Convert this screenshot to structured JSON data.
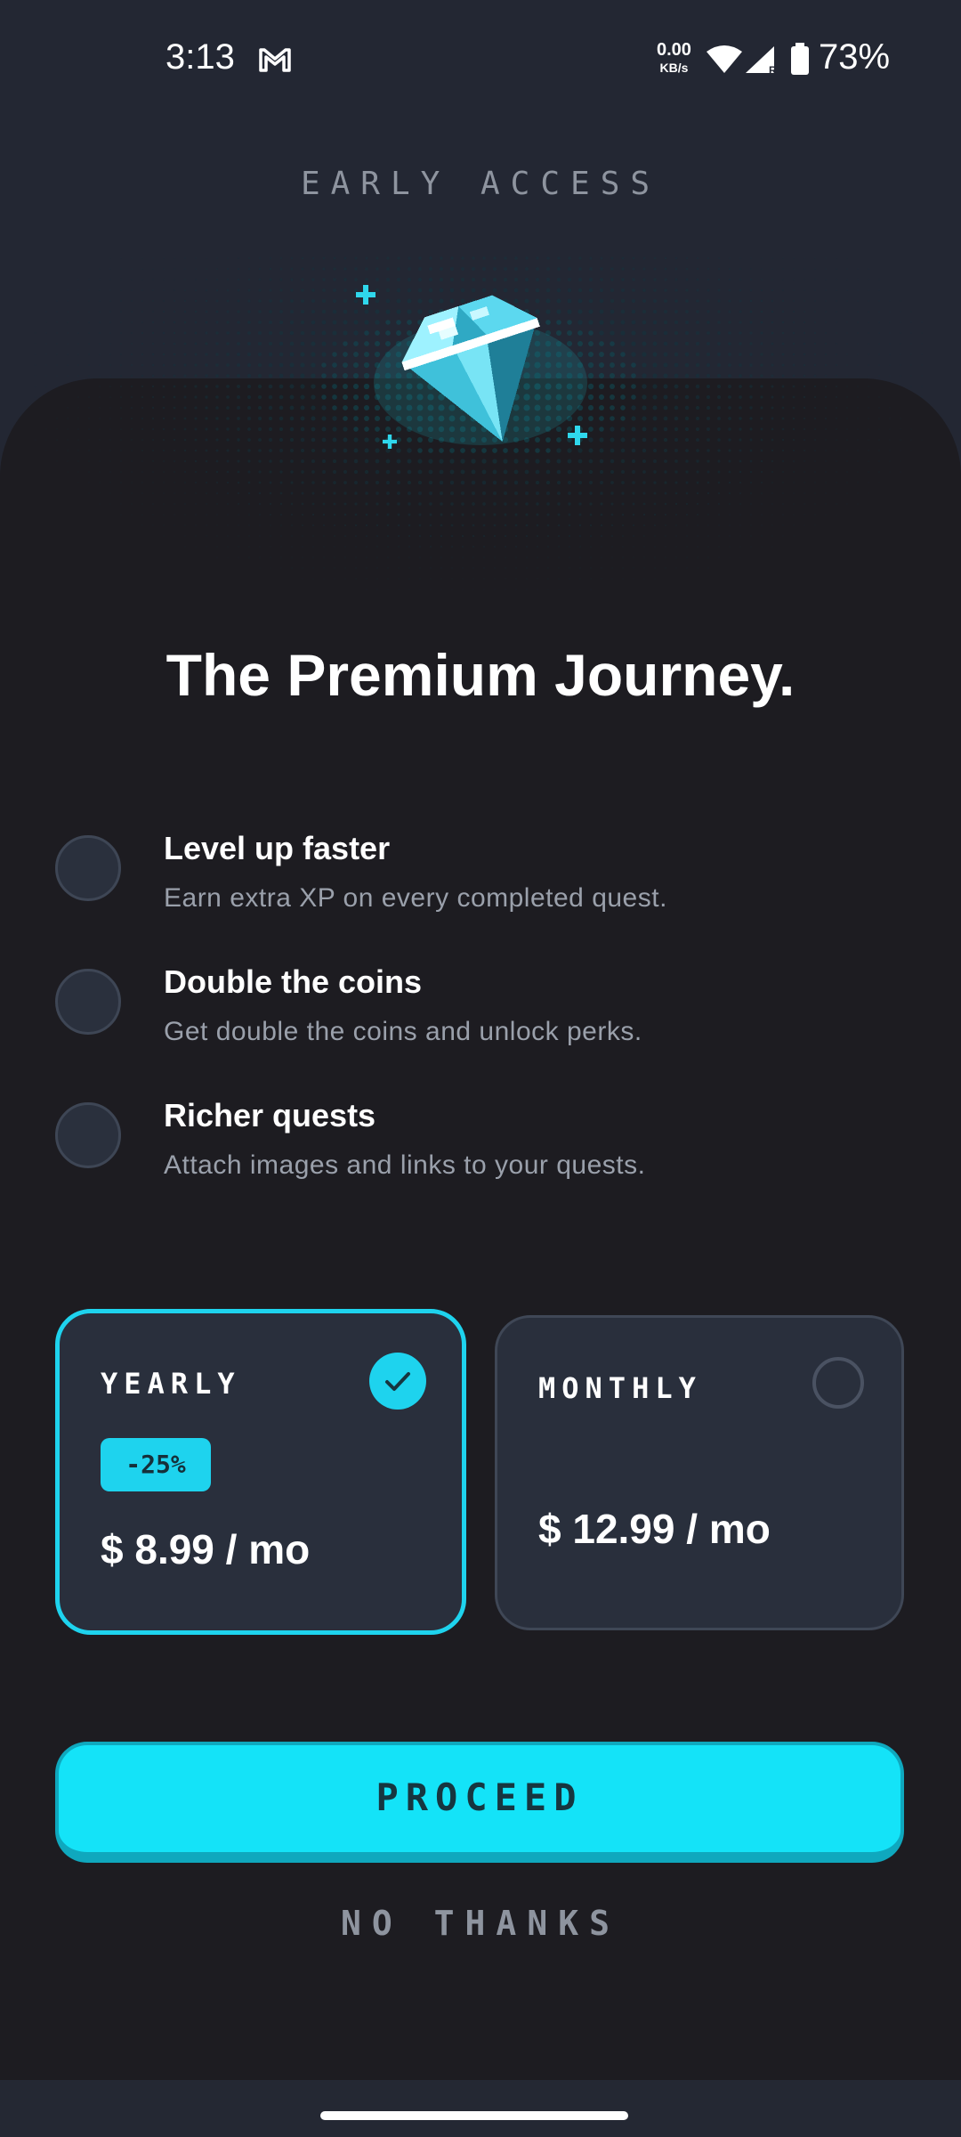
{
  "status_bar": {
    "time": "3:13",
    "net_speed_value": "0.00",
    "net_speed_unit": "KB/s",
    "battery": "73%",
    "icons": [
      "gmail-icon",
      "wifi-icon",
      "signal-icon",
      "battery-icon"
    ]
  },
  "header": {
    "eyebrow": "EARLY ACCESS",
    "hero_icon": "diamond-gem-icon"
  },
  "title": "The Premium Journey.",
  "features": [
    {
      "title": "Level up faster",
      "description": "Earn extra XP on every completed quest."
    },
    {
      "title": "Double the coins",
      "description": "Get double the coins and unlock perks."
    },
    {
      "title": "Richer quests",
      "description": "Attach images and links to your quests."
    }
  ],
  "plans": {
    "yearly": {
      "name": "YEARLY",
      "badge": "-25%",
      "price": "$ 8.99 / mo",
      "selected": true
    },
    "monthly": {
      "name": "MONTHLY",
      "price": "$ 12.99 / mo",
      "selected": false
    }
  },
  "actions": {
    "proceed_label": "PROCEED",
    "no_thanks_label": "NO THANKS"
  },
  "colors": {
    "accent": "#14e3f8",
    "background": "#1d1c21",
    "card": "#292f3c",
    "muted_text": "#9aa0ab"
  }
}
